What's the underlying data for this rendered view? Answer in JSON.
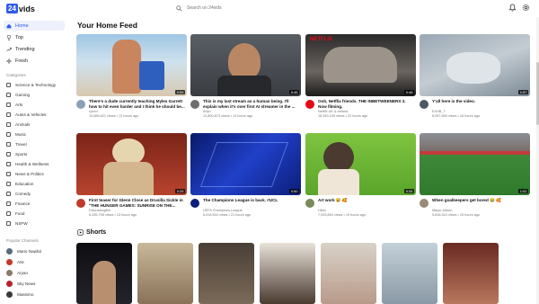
{
  "header": {
    "logo_badge": "24",
    "logo_text": "vids",
    "search_placeholder": "Search on 24vids"
  },
  "sidebar": {
    "nav": [
      {
        "label": "Home",
        "icon": "home-icon"
      },
      {
        "label": "Top",
        "icon": "trophy-icon"
      },
      {
        "label": "Trending",
        "icon": "trending-icon"
      },
      {
        "label": "Fresh",
        "icon": "fresh-icon"
      }
    ],
    "categories_title": "Categories",
    "categories": [
      "Science & Technology",
      "Gaming",
      "Arts",
      "Autos & Vehicles",
      "Animals",
      "Music",
      "Travel",
      "Sports",
      "Health & Wellness",
      "News & Politics",
      "Education",
      "Comedy",
      "Finance",
      "Food",
      "NSFW"
    ],
    "channels_title": "Popular Channels",
    "channels": [
      "Mario Nawfal",
      "ANI",
      "Aryan",
      "Sky News",
      "Massimo"
    ]
  },
  "main": {
    "feed_title": "Your Home Feed",
    "videos": [
      {
        "title": "There's a dude currently teaching Myles Garrett how to hit even harder and I think he should be...",
        "channel": "ryzzvl",
        "stats": "19,886,621 views • 13 hours ago",
        "duration": "0:55"
      },
      {
        "title": "This is my last stream as a human being. I'll explain when it's over first AI streamer in the ...",
        "channel": "Arlyn",
        "stats": "12,890,873 views • 13 hours ago",
        "duration": "0:45"
      },
      {
        "title": "Ooh, Netflix friends. THE INBETWEENERS 3. Now filming.",
        "channel": "Netflix UK & Ireland",
        "stats": "18,283,105 views • 22 hours ago",
        "duration": "0:48"
      },
      {
        "title": "Y'all here is the video.",
        "channel": "EXHB_T",
        "stats": "8,957,859 views • 16 hours ago",
        "duration": "1:57"
      },
      {
        "title": "First teaser for Glenn Close as Drusilla Sickle in \"THE HUNGER GAMES: SUNRISE ON THE...",
        "channel": "Discussingfilm",
        "stats": "6,336,798 views • 13 hours ago",
        "duration": "0:25"
      },
      {
        "title": "The Champions League is back. #UCL",
        "channel": "UEFA Champions League",
        "stats": "6,418,504 views • 21 hours ago",
        "duration": "0:50"
      },
      {
        "title": "Art work 😅 🥰",
        "channel": "Hilda",
        "stats": "7,025,854 views • 19 hours ago",
        "duration": "0:34"
      },
      {
        "title": "When goalkeepers get bored 😂 🥰",
        "channel": "Mayor Adrien",
        "stats": "5,816,324 views • 15 hours ago",
        "duration": "1:02"
      }
    ],
    "shorts_title": "Shorts"
  }
}
